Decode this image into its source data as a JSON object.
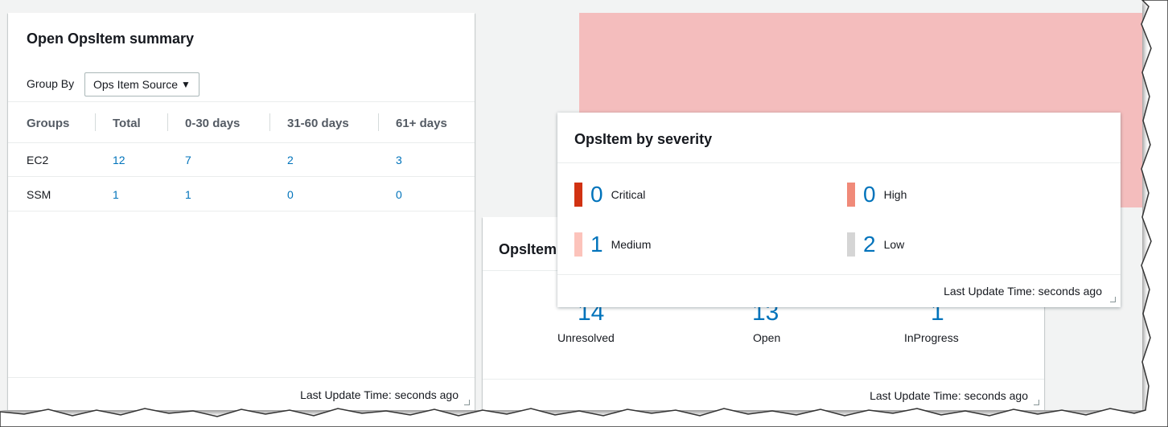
{
  "summary": {
    "title": "Open OpsItem summary",
    "group_by_label": "Group By",
    "group_by_value": "Ops Item Source",
    "columns": [
      "Groups",
      "Total",
      "0-30 days",
      "31-60 days",
      "61+ days"
    ],
    "rows": [
      {
        "group": "EC2",
        "total": "12",
        "d0_30": "7",
        "d31_60": "2",
        "d61": "3"
      },
      {
        "group": "SSM",
        "total": "1",
        "d0_30": "1",
        "d31_60": "0",
        "d61": "0"
      }
    ],
    "footer": "Last Update Time: seconds ago"
  },
  "status": {
    "title": "OpsItem",
    "counts": [
      {
        "value": "14",
        "label": "Unresolved"
      },
      {
        "value": "13",
        "label": "Open"
      },
      {
        "value": "1",
        "label": "InProgress"
      }
    ],
    "footer": "Last Update Time: seconds ago"
  },
  "severity": {
    "title": "OpsItem by severity",
    "items": [
      {
        "value": "0",
        "label": "Critical",
        "color": "#d13212"
      },
      {
        "value": "0",
        "label": "High",
        "color": "#f08a79"
      },
      {
        "value": "1",
        "label": "Medium",
        "color": "#fcc3bb"
      },
      {
        "value": "2",
        "label": "Low",
        "color": "#d5d5d5"
      }
    ],
    "footer": "Last Update Time: seconds ago"
  },
  "colors": {
    "link": "#0073bb",
    "highlight": "#f4bdbd",
    "background": "#f2f3f3"
  }
}
